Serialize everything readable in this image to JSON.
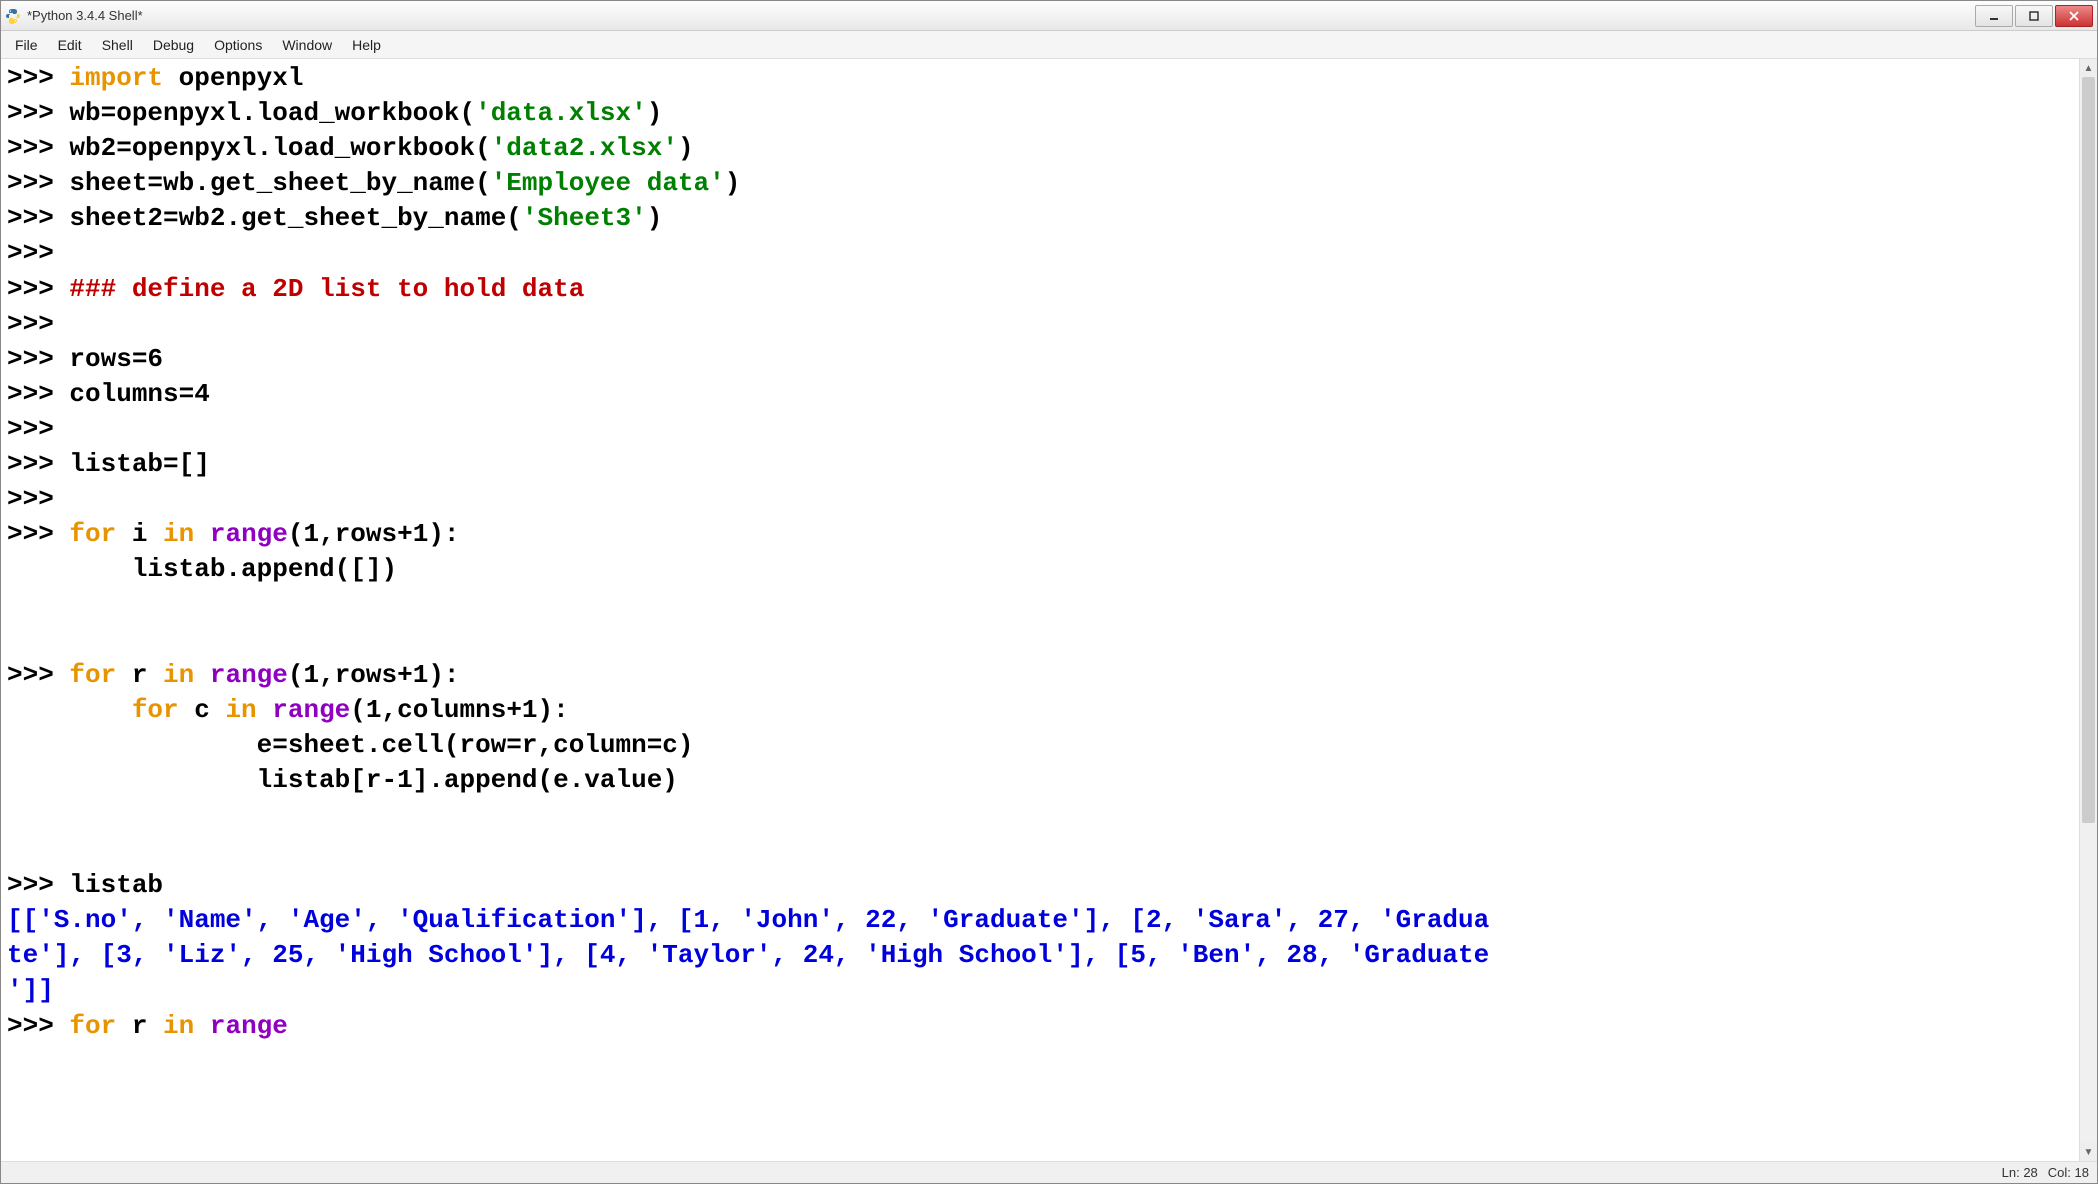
{
  "window": {
    "title": "*Python 3.4.4 Shell*"
  },
  "menubar": [
    "File",
    "Edit",
    "Shell",
    "Debug",
    "Options",
    "Window",
    "Help"
  ],
  "prompt": ">>> ",
  "code": {
    "l1_import": "import",
    "l1_rest": " openpyxl",
    "l2_a": "wb=openpyxl.load_workbook(",
    "l2_str": "'data.xlsx'",
    "l2_b": ")",
    "l3_a": "wb2=openpyxl.load_workbook(",
    "l3_str": "'data2.xlsx'",
    "l3_b": ")",
    "l4_a": "sheet=wb.get_sheet_by_name(",
    "l4_str": "'Employee data'",
    "l4_b": ")",
    "l5_a": "sheet2=wb2.get_sheet_by_name(",
    "l5_str": "'Sheet3'",
    "l5_b": ")",
    "comment": "### define a 2D list to hold data",
    "l_rows": "rows=6",
    "l_cols": "columns=4",
    "l_listab": "listab=[]",
    "for1_for": "for",
    "for1_i": " i ",
    "for1_in": "in",
    "for1_rng": " range",
    "for1_args": "(1,rows+1):",
    "for1_body": "        listab.append([])",
    "for2_for": "for",
    "for2_r": " r ",
    "for2_in": "in",
    "for2_rng": " range",
    "for2_args": "(1,rows+1):",
    "for2c_pad": "        ",
    "for2c_for": "for",
    "for2c_c": " c ",
    "for2c_in": "in",
    "for2c_rng": " range",
    "for2c_args": "(1,columns+1):",
    "for2_body1": "                e=sheet.cell(row=r,column=c)",
    "for2_body2": "                listab[r-1].append(e.value)",
    "l_listab2": "listab",
    "out1": "[['S.no', 'Name', 'Age', 'Qualification'], [1, 'John', 22, 'Graduate'], [2, 'Sara', 27, 'Gradua",
    "out2": "te'], [3, 'Liz', 25, 'High School'], [4, 'Taylor', 24, 'High School'], [5, 'Ben', 28, 'Graduate",
    "out3": "']]",
    "last_for": "for",
    "last_r": " r ",
    "last_in": "in",
    "last_rng": " range"
  },
  "status": {
    "line": "Ln: 28",
    "col": "Col: 18"
  }
}
